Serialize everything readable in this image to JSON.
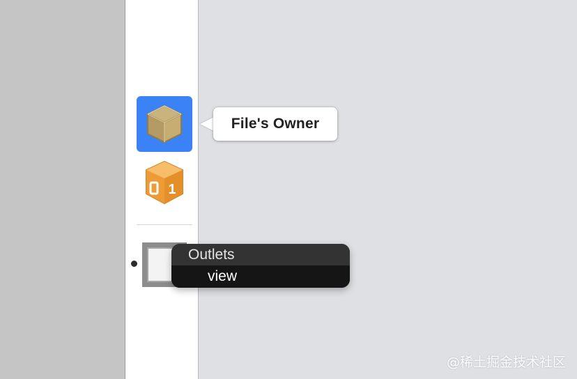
{
  "tooltip": {
    "label": "File's Owner"
  },
  "dock": {
    "items": [
      {
        "icon": "files-owner-cube-icon"
      },
      {
        "icon": "first-responder-cube-icon",
        "badge": "1"
      },
      {
        "icon": "view-object-icon"
      }
    ]
  },
  "outlets": {
    "header": "Outlets",
    "items": [
      "view"
    ]
  },
  "watermark": "@稀土掘金技术社区",
  "colors": {
    "selection": "#3b82f6",
    "canvas": "#dfe0e4",
    "dock_bg": "#ffffff",
    "gutter": "#c5c5c5",
    "responder_orange": "#f0a040",
    "hud_header": "#333333",
    "hud_body": "#151515"
  }
}
